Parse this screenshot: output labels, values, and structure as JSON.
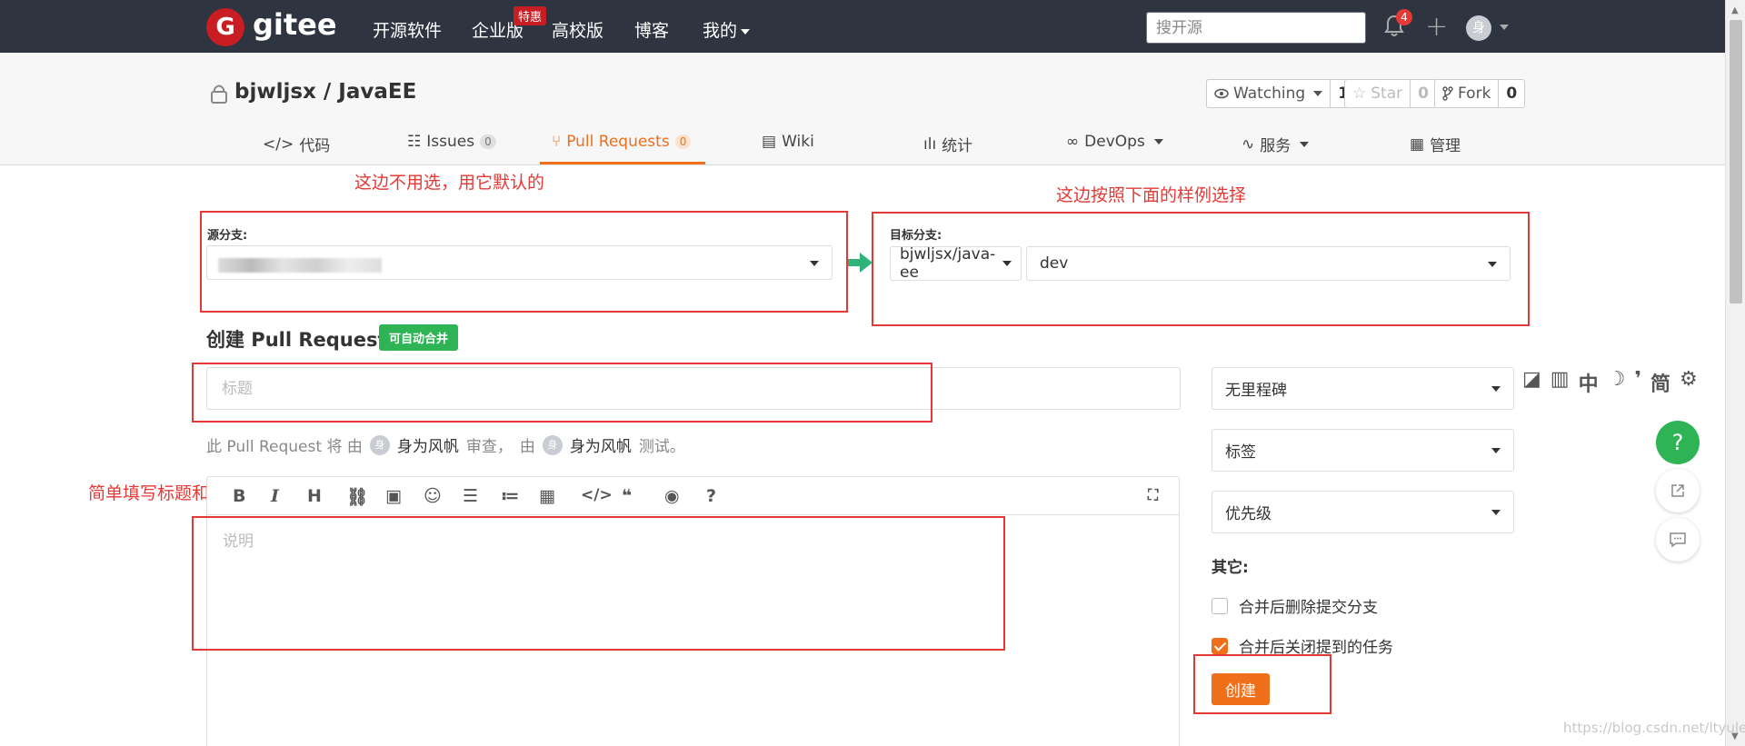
{
  "topnav": {
    "logo_letter": "G",
    "logo_text": "gitee",
    "items": [
      "开源软件",
      "企业版",
      "高校版",
      "博客",
      "我的"
    ],
    "enterprise_badge": "特惠",
    "search_placeholder": "搜开源",
    "notification_count": "4",
    "avatar_letter": "身"
  },
  "project": {
    "title": "bjwljsx / JavaEE",
    "watching_label": "Watching",
    "watching_count": "1",
    "star_label": "Star",
    "star_count": "0",
    "fork_label": "Fork",
    "fork_count": "0"
  },
  "tabs": [
    {
      "label": "代码"
    },
    {
      "label": "Issues",
      "count": "0"
    },
    {
      "label": "Pull Requests",
      "count": "0"
    },
    {
      "label": "Wiki"
    },
    {
      "label": "统计"
    },
    {
      "label": "DevOps"
    },
    {
      "label": "服务"
    },
    {
      "label": "管理"
    }
  ],
  "annotations": {
    "source_note": "这边不用选，用它默认的",
    "target_note": "这边按照下面的样例选择",
    "title_note": "简单填写标题和修改说明"
  },
  "branch": {
    "source_label": "源分支:",
    "target_label": "目标分支:",
    "target_repo": "bjwljsx/java-ee",
    "target_branch": "dev"
  },
  "form": {
    "heading": "创建 Pull Request",
    "auto_merge_badge": "可自动合并",
    "title_placeholder": "标题",
    "reviewer_prefix": "此 Pull Request 将 由",
    "reviewer_name": "身为风帆",
    "reviewer_action": "审查，",
    "tester_prefix": "由",
    "tester_name": "身为风帆",
    "tester_action": "测试。",
    "avatar_letter": "身",
    "description_placeholder": "说明"
  },
  "sidebar": {
    "milestone": "无里程碑",
    "labels": "标签",
    "priority": "优先级",
    "other_heading": "其它:",
    "delete_branch_label": "合并后删除提交分支",
    "delete_branch_checked": false,
    "close_issues_label": "合并后关闭提到的任务",
    "close_issues_checked": true,
    "create_button": "创建"
  },
  "ime": [
    "中",
    "简"
  ],
  "help_label": "?",
  "watermark": "https://blog.csdn.net/ltyulet"
}
